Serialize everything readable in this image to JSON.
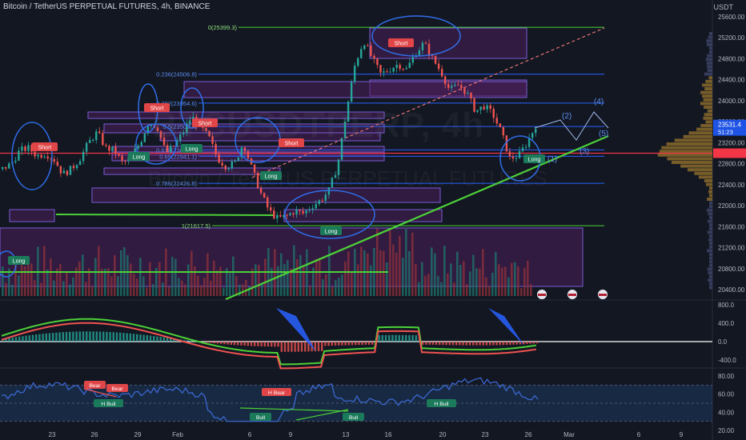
{
  "header": {
    "title": "Bitcoin / TetherUS PERPETUAL FUTURES, 4h, BINANCE",
    "currency": "USDT",
    "watermark_symbol": "BTCUSDTPERP, 4h",
    "watermark_name": "Bitcoin / TetherUS PERPETUAL FUTURES"
  },
  "colors": {
    "background": "#131722",
    "up": "#26a69a",
    "down": "#ef5350",
    "fib_line": "#2962ff",
    "fib_label": "#5b8def",
    "trendline": "#4cd137",
    "zone_fill": "#4a1f5a",
    "zone_border": "#7b5bd6",
    "drawing": "#2f6ee8",
    "red_line": "#f23645",
    "rsi": "#3d6bdb",
    "rsi_band": "#1e3a5f"
  },
  "chart_data": [
    {
      "type": "candlestick",
      "title": "Bitcoin / TetherUS PERPETUAL FUTURES, 4h, BINANCE",
      "ylabel": "USDT",
      "ylim": [
        20300,
        25700
      ],
      "y_ticks": [
        "25600.00",
        "25200.00",
        "24800.00",
        "24400.00",
        "24000.00",
        "23600.00",
        "23200.00",
        "22800.00",
        "22400.00",
        "22000.00",
        "21600.00",
        "21200.00",
        "20800.00",
        "20400.00"
      ],
      "x_ticks": [
        "23",
        "26",
        "29",
        "Feb",
        "6",
        "9",
        "13",
        "16",
        "20",
        "23",
        "26",
        "Mar",
        "6",
        "9"
      ],
      "current_price": {
        "value": 23531.4,
        "label": "23531.4",
        "countdown": "51:23"
      },
      "marker_price": 23000,
      "fib_levels": [
        {
          "label": "0(25399.3)",
          "value": 25399.3
        },
        {
          "label": "0.236(24506.8)",
          "value": 24506.8
        },
        {
          "label": "0.382(23954.6)",
          "value": 23954.6
        },
        {
          "label": "0.5(23508.4)",
          "value": 23508.4
        },
        {
          "label": "0.618(23062.1)",
          "value": 23062.1
        },
        {
          "label": "0.65(22941.1)",
          "value": 22941.1
        },
        {
          "label": "0.786(22426.8)",
          "value": 22426.8
        },
        {
          "label": "1(21617.5)",
          "value": 21617.5
        }
      ],
      "wave_labels": [
        "(1)",
        "(2)",
        "(3)",
        "(4)",
        "(5)"
      ],
      "signals": [
        {
          "text": "Short",
          "kind": "short"
        },
        {
          "text": "Short",
          "kind": "short"
        },
        {
          "text": "Short",
          "kind": "short"
        },
        {
          "text": "Short",
          "kind": "short"
        },
        {
          "text": "Short",
          "kind": "short"
        },
        {
          "text": "Long",
          "kind": "long"
        },
        {
          "text": "Long",
          "kind": "long"
        },
        {
          "text": "Long",
          "kind": "long"
        },
        {
          "text": "Long",
          "kind": "long"
        },
        {
          "text": "Long",
          "kind": "long"
        },
        {
          "text": "Long",
          "kind": "long"
        }
      ],
      "close_series": [
        22700,
        22800,
        23050,
        23100,
        22950,
        23000,
        22880,
        22600,
        22700,
        22900,
        23200,
        23400,
        23100,
        23050,
        22800,
        22950,
        23200,
        23600,
        23500,
        23000,
        23150,
        23400,
        23700,
        23500,
        23300,
        22900,
        22750,
        22800,
        23200,
        22700,
        22250,
        21900,
        21750,
        21800,
        21900,
        21850,
        22000,
        22100,
        22300,
        22800,
        23800,
        24700,
        25150,
        24800,
        24500,
        24600,
        24700,
        24600,
        24900,
        25100,
        24800,
        24550,
        24200,
        24300,
        24150,
        23800,
        23900,
        23750,
        23400,
        22900,
        22950,
        23200,
        23531
      ]
    },
    {
      "type": "histogram",
      "title": "",
      "ylim": [
        -600,
        900
      ],
      "y_ticks": [
        "800.0",
        "400.0",
        "0.0",
        "-400.0"
      ]
    },
    {
      "type": "line",
      "title": "",
      "ylim": [
        28,
        92
      ],
      "y_ticks": [
        "80.00",
        "60.00",
        "40.00",
        "20.00"
      ],
      "divergence_labels": [
        "Bear",
        "Bear",
        "H Bull",
        "H Bear",
        "Bull",
        "Bull",
        "H Bull"
      ]
    }
  ]
}
